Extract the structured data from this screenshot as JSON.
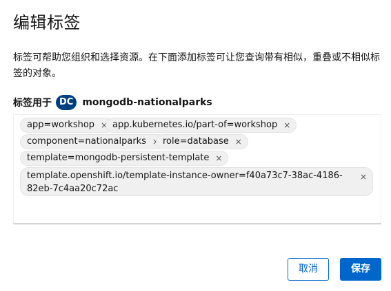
{
  "modal": {
    "title": "编辑标签",
    "description": "标签可帮助您组织和选择资源。在下面添加标签可让您查询带有相似，重叠或不相似标签的对象。",
    "labels_for_prefix": "标签用于",
    "resource_badge": "DC",
    "resource_name": "mongodb-nationalparks",
    "labels": [
      "app=workshop",
      "app.kubernetes.io/part-of=workshop",
      "component=nationalparks",
      "role=database",
      "template=mongodb-persistent-template",
      "template.openshift.io/template-instance-owner=f40a73c7-38ac-4186-82eb-7c4aa20c72ac"
    ],
    "remove_glyph": "×",
    "cancel_label": "取消",
    "save_label": "保存"
  },
  "colors": {
    "primary": "#0066cc",
    "badge_bg": "#004080",
    "chip_bg": "#f0f0f0"
  }
}
